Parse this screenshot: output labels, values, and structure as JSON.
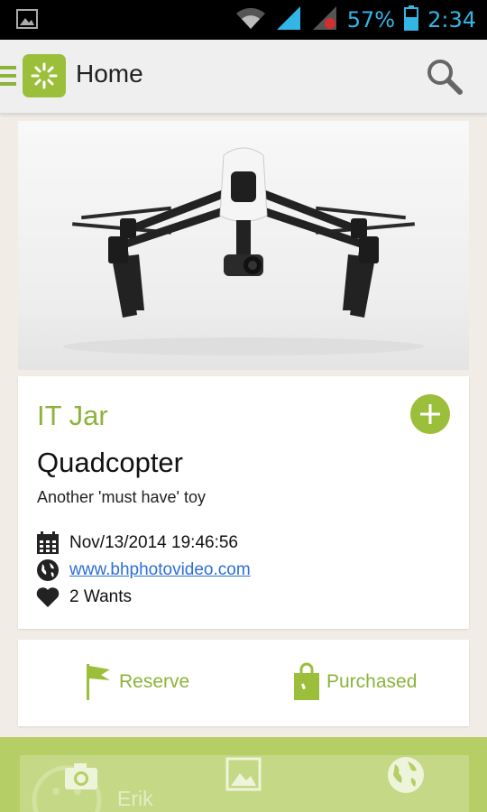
{
  "status_bar": {
    "battery_percent": "57%",
    "time": "2:34",
    "icons": [
      "image-notification-icon",
      "wifi-icon",
      "signal-icon",
      "signal-roaming-icon",
      "battery-icon"
    ]
  },
  "action_bar": {
    "title": "Home",
    "icons": [
      "menu-icon",
      "app-logo-icon",
      "search-icon"
    ]
  },
  "item": {
    "jar": "IT Jar",
    "title": "Quadcopter",
    "description": "Another 'must have' toy",
    "date": "Nov/13/2014 19:46:56",
    "url": "www.bhphotovideo.com",
    "wants": "2 Wants"
  },
  "actions": {
    "reserve": "Reserve",
    "purchased": "Purchased"
  },
  "bottom": {
    "user_name": "Erik",
    "icons": [
      "camera-icon",
      "gallery-icon",
      "globe-icon"
    ]
  },
  "colors": {
    "accent": "#9cbf3b",
    "accent_text": "#8db33a",
    "status_blue": "#33b5e5",
    "link": "#2d6fd6"
  }
}
